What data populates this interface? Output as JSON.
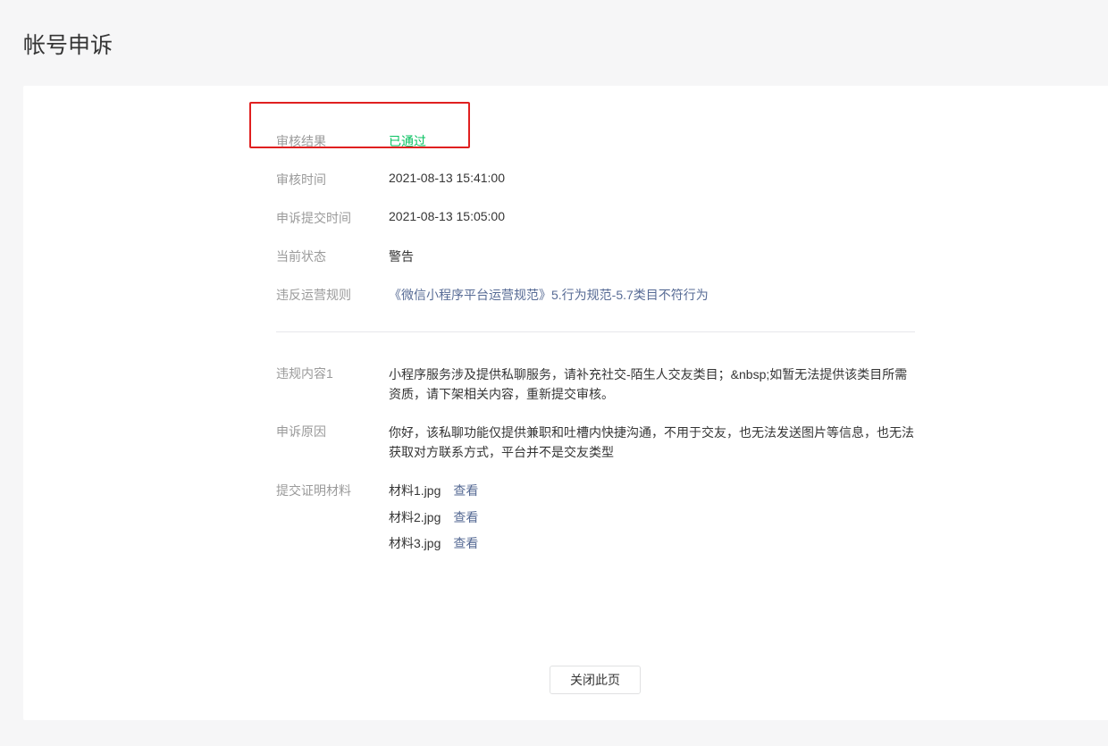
{
  "page": {
    "title": "帐号申诉"
  },
  "details": {
    "review_result": {
      "label": "审核结果",
      "value": "已通过"
    },
    "review_time": {
      "label": "审核时间",
      "value": "2021-08-13 15:41:00"
    },
    "submit_time": {
      "label": "申诉提交时间",
      "value": "2021-08-13 15:05:00"
    },
    "current_status": {
      "label": "当前状态",
      "value": "警告"
    },
    "violated_rule": {
      "label": "违反运营规则",
      "value": "《微信小程序平台运营规范》5.行为规范-5.7类目不符行为"
    }
  },
  "violation": {
    "label": "违规内容1",
    "text": "小程序服务涉及提供私聊服务，请补充社交-陌生人交友类目；&nbsp;如暂无法提供该类目所需资质，请下架相关内容，重新提交审核。"
  },
  "appeal": {
    "label": "申诉原因",
    "text": "你好，该私聊功能仅提供兼职和吐槽内快捷沟通，不用于交友，也无法发送图片等信息，也无法获取对方联系方式，平台并不是交友类型"
  },
  "materials": {
    "label": "提交证明材料",
    "files": [
      {
        "name": "材料1.jpg",
        "action": "查看"
      },
      {
        "name": "材料2.jpg",
        "action": "查看"
      },
      {
        "name": "材料3.jpg",
        "action": "查看"
      }
    ]
  },
  "footer": {
    "close_label": "关闭此页"
  },
  "colors": {
    "pass": "#07c160",
    "link": "#576b95",
    "highlight": "#e02020"
  }
}
